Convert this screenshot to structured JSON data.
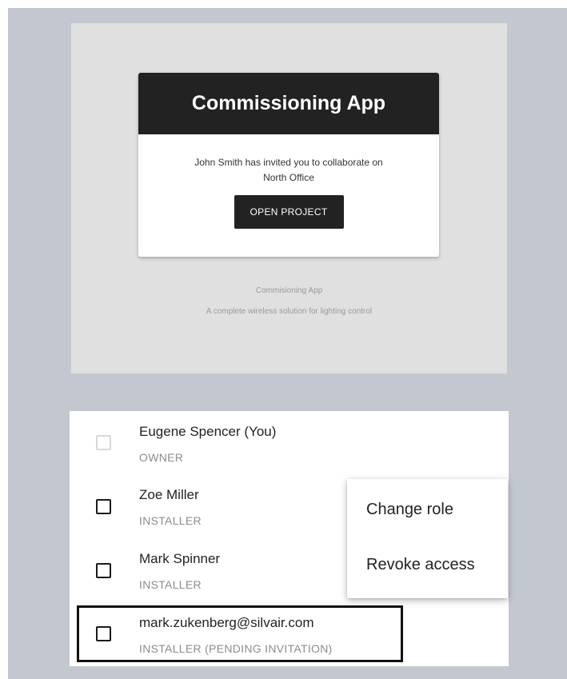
{
  "email": {
    "app_title": "Commissioning App",
    "invite_line1": "John Smith has invited you to collaborate on",
    "invite_line2": "North Office",
    "open_button": "OPEN PROJECT",
    "footer_app": "Commisioning App",
    "footer_tagline": "A complete wireless solution for lighting control"
  },
  "collaborators": [
    {
      "name": "Eugene Spencer (You)",
      "role": "OWNER",
      "checkbox_enabled": false
    },
    {
      "name": "Zoe Miller",
      "role": "INSTALLER",
      "checkbox_enabled": true
    },
    {
      "name": "Mark Spinner",
      "role": "INSTALLER",
      "checkbox_enabled": true
    },
    {
      "name": "mark.zukenberg@silvair.com",
      "role": "INSTALLER (PENDING INVITATION)",
      "checkbox_enabled": true
    }
  ],
  "context_menu": {
    "items": [
      "Change role",
      "Revoke access"
    ]
  },
  "colors": {
    "frame_background": "#c3c8d0",
    "email_background": "#e0e0e0",
    "header_dark": "#222222",
    "muted_text": "#8c8c8c"
  }
}
